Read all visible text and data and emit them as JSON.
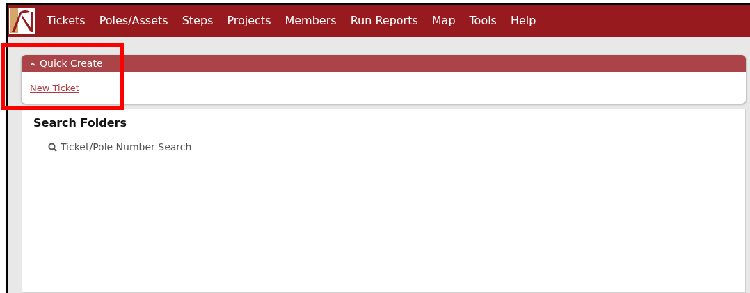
{
  "nav": {
    "items": [
      "Tickets",
      "Poles/Assets",
      "Steps",
      "Projects",
      "Members",
      "Run Reports",
      "Map",
      "Tools",
      "Help"
    ]
  },
  "quick_create": {
    "title": "Quick Create",
    "expanded": true,
    "links": [
      "New Ticket"
    ],
    "highlighted": true
  },
  "search_folders": {
    "title": "Search Folders",
    "items": [
      "Ticket/Pole Number Search"
    ]
  }
}
